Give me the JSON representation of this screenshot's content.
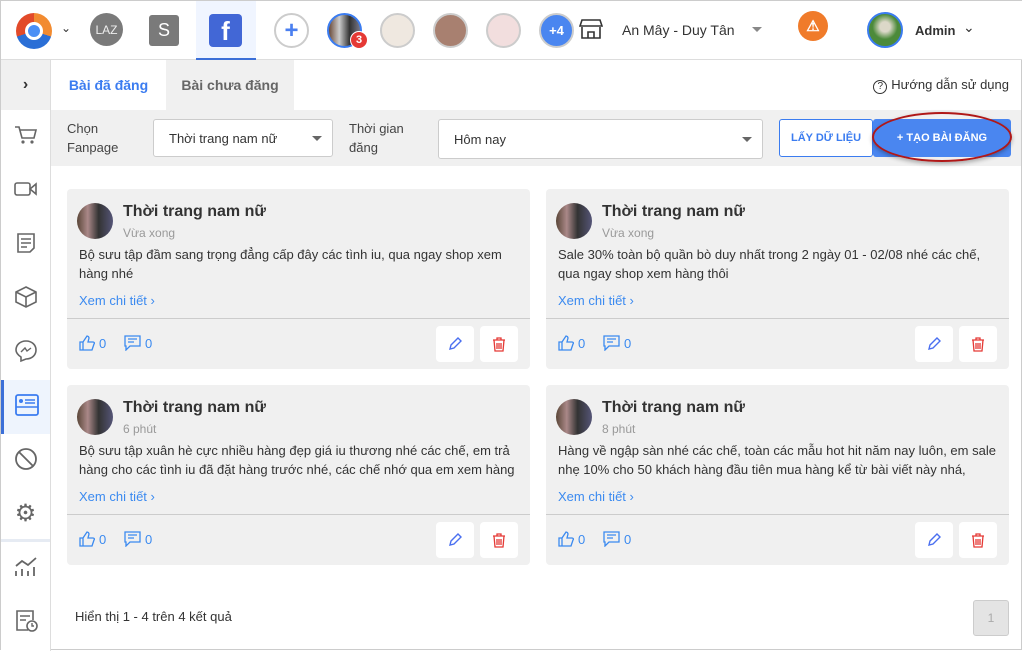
{
  "topbar": {
    "channels": [
      {
        "name": "lazada",
        "label": "LAZ"
      },
      {
        "name": "shopee",
        "label": "S"
      },
      {
        "name": "facebook",
        "label": "f"
      }
    ],
    "page_badge": "3",
    "more_pages": "+4",
    "store": "An Mây - Duy Tân",
    "user": "Admin"
  },
  "tabs": [
    {
      "label": "Bài đã đăng",
      "active": true
    },
    {
      "label": "Bài chưa đăng",
      "active": false
    }
  ],
  "help": "Hướng dẫn sử dụng",
  "filter": {
    "fanpage_label_1": "Chọn",
    "fanpage_label_2": "Fanpage",
    "fanpage_value": "Thời trang nam nữ",
    "time_label_1": "Thời gian",
    "time_label_2": "đăng",
    "time_value": "Hôm nay",
    "fetch": "LẤY DỮ LIỆU",
    "create": "+ TẠO BÀI ĐĂNG"
  },
  "posts": [
    {
      "page": "Thời trang nam nữ",
      "time": "Vừa xong",
      "text": "Bộ sưu tập đầm sang trọng đẳng cấp đây các tình iu, qua ngay shop xem hàng nhé",
      "more": "Xem chi tiết",
      "likes": "0",
      "comments": "0"
    },
    {
      "page": "Thời trang nam nữ",
      "time": "Vừa xong",
      "text": "Sale 30% toàn bộ quần bò duy nhất trong 2 ngày 01 - 02/08 nhé các chế, qua ngay shop xem hàng thôi",
      "more": "Xem chi tiết",
      "likes": "0",
      "comments": "0"
    },
    {
      "page": "Thời trang nam nữ",
      "time": "6 phút",
      "text": "Bộ sưu tập xuân hè cực nhiều hàng đẹp giá iu thương nhé các chế, em trả hàng cho các tình iu đã đặt hàng trước nhé, các chế nhớ qua em xem hàng",
      "more": "Xem chi tiết",
      "likes": "0",
      "comments": "0"
    },
    {
      "page": "Thời trang nam nữ",
      "time": "8 phút",
      "text": "Hàng về ngập sàn nhé các chế, toàn các mẫu hot hit năm nay luôn, em sale nhẹ 10% cho 50 khách hàng đầu tiên mua hàng kể từ bài viết này nhá, nhanh",
      "more": "Xem chi tiết",
      "likes": "0",
      "comments": "0"
    }
  ],
  "footer": {
    "summary": "Hiển thị 1 - 4 trên 4 kết quả",
    "page": "1"
  },
  "colors": {
    "accent": "#3b7cf0",
    "facebook": "#4267d6",
    "warning": "#f07b2a",
    "danger": "#e53935",
    "highlight_ring": "#b01818"
  }
}
